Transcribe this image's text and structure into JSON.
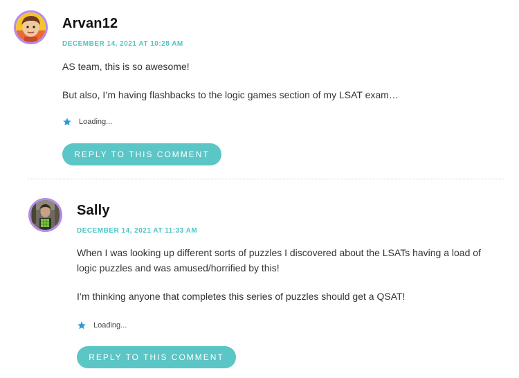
{
  "comments": [
    {
      "author": "Arvan12",
      "date": "DECEMBER 14, 2021 AT 10:28 AM",
      "paragraphs": [
        "AS team, this is so awesome!",
        "But also, I’m having flashbacks to the logic games section of my LSAT exam…"
      ],
      "like_text": "Loading...",
      "reply_label": "REPLY TO THIS COMMENT",
      "avatar_icon": "cartoon-face-avatar"
    },
    {
      "author": "Sally",
      "date": "DECEMBER 14, 2021 AT 11:33 AM",
      "paragraphs": [
        "When I was looking up different sorts of puzzles I discovered about the LSATs having a load of logic puzzles and was amused/horrified by this!",
        "I’m thinking anyone that completes this series of puzzles should get a QSAT!"
      ],
      "like_text": "Loading...",
      "reply_label": "REPLY TO THIS COMMENT",
      "avatar_icon": "photo-avatar"
    }
  ],
  "colors": {
    "accent": "#5cc5c5",
    "date": "#4fc3c3",
    "avatar_border": "#b48ce8",
    "star": "#2a9bd6"
  }
}
